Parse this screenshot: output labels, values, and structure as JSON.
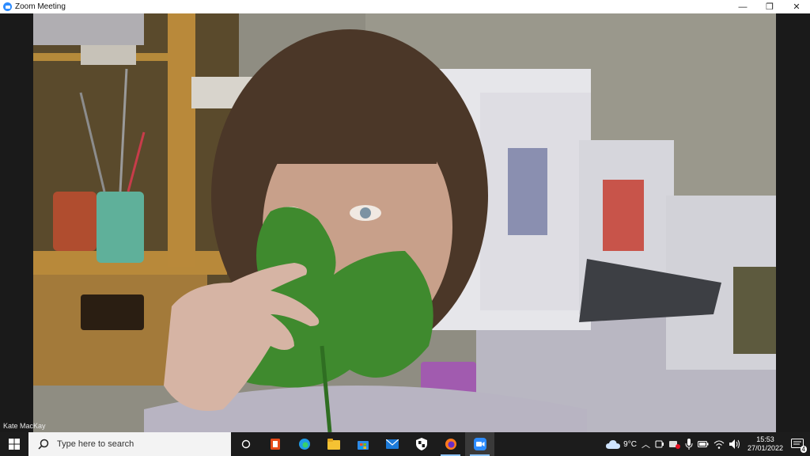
{
  "window": {
    "title": "Zoom Meeting",
    "controls": {
      "minimize": "—",
      "restore": "❐",
      "close": "✕"
    }
  },
  "video": {
    "participant_name": "Kate MacKay"
  },
  "taskbar": {
    "search_placeholder": "Type here to search",
    "pinned_apps": [
      "task-view-icon",
      "office-icon",
      "edge-icon",
      "file-explorer-icon",
      "store-icon",
      "mail-icon",
      "security-icon",
      "firefox-icon",
      "zoom-icon"
    ],
    "weather": {
      "temperature": "9°C"
    },
    "clock": {
      "time": "15:53",
      "date": "27/01/2022"
    },
    "notifications": {
      "count": "4"
    }
  },
  "colors": {
    "titlebar": "#ffffff",
    "taskbar": "#1c1c1c",
    "zoom_blue": "#2d8cff",
    "leaf_green": "#3f8a2e"
  }
}
